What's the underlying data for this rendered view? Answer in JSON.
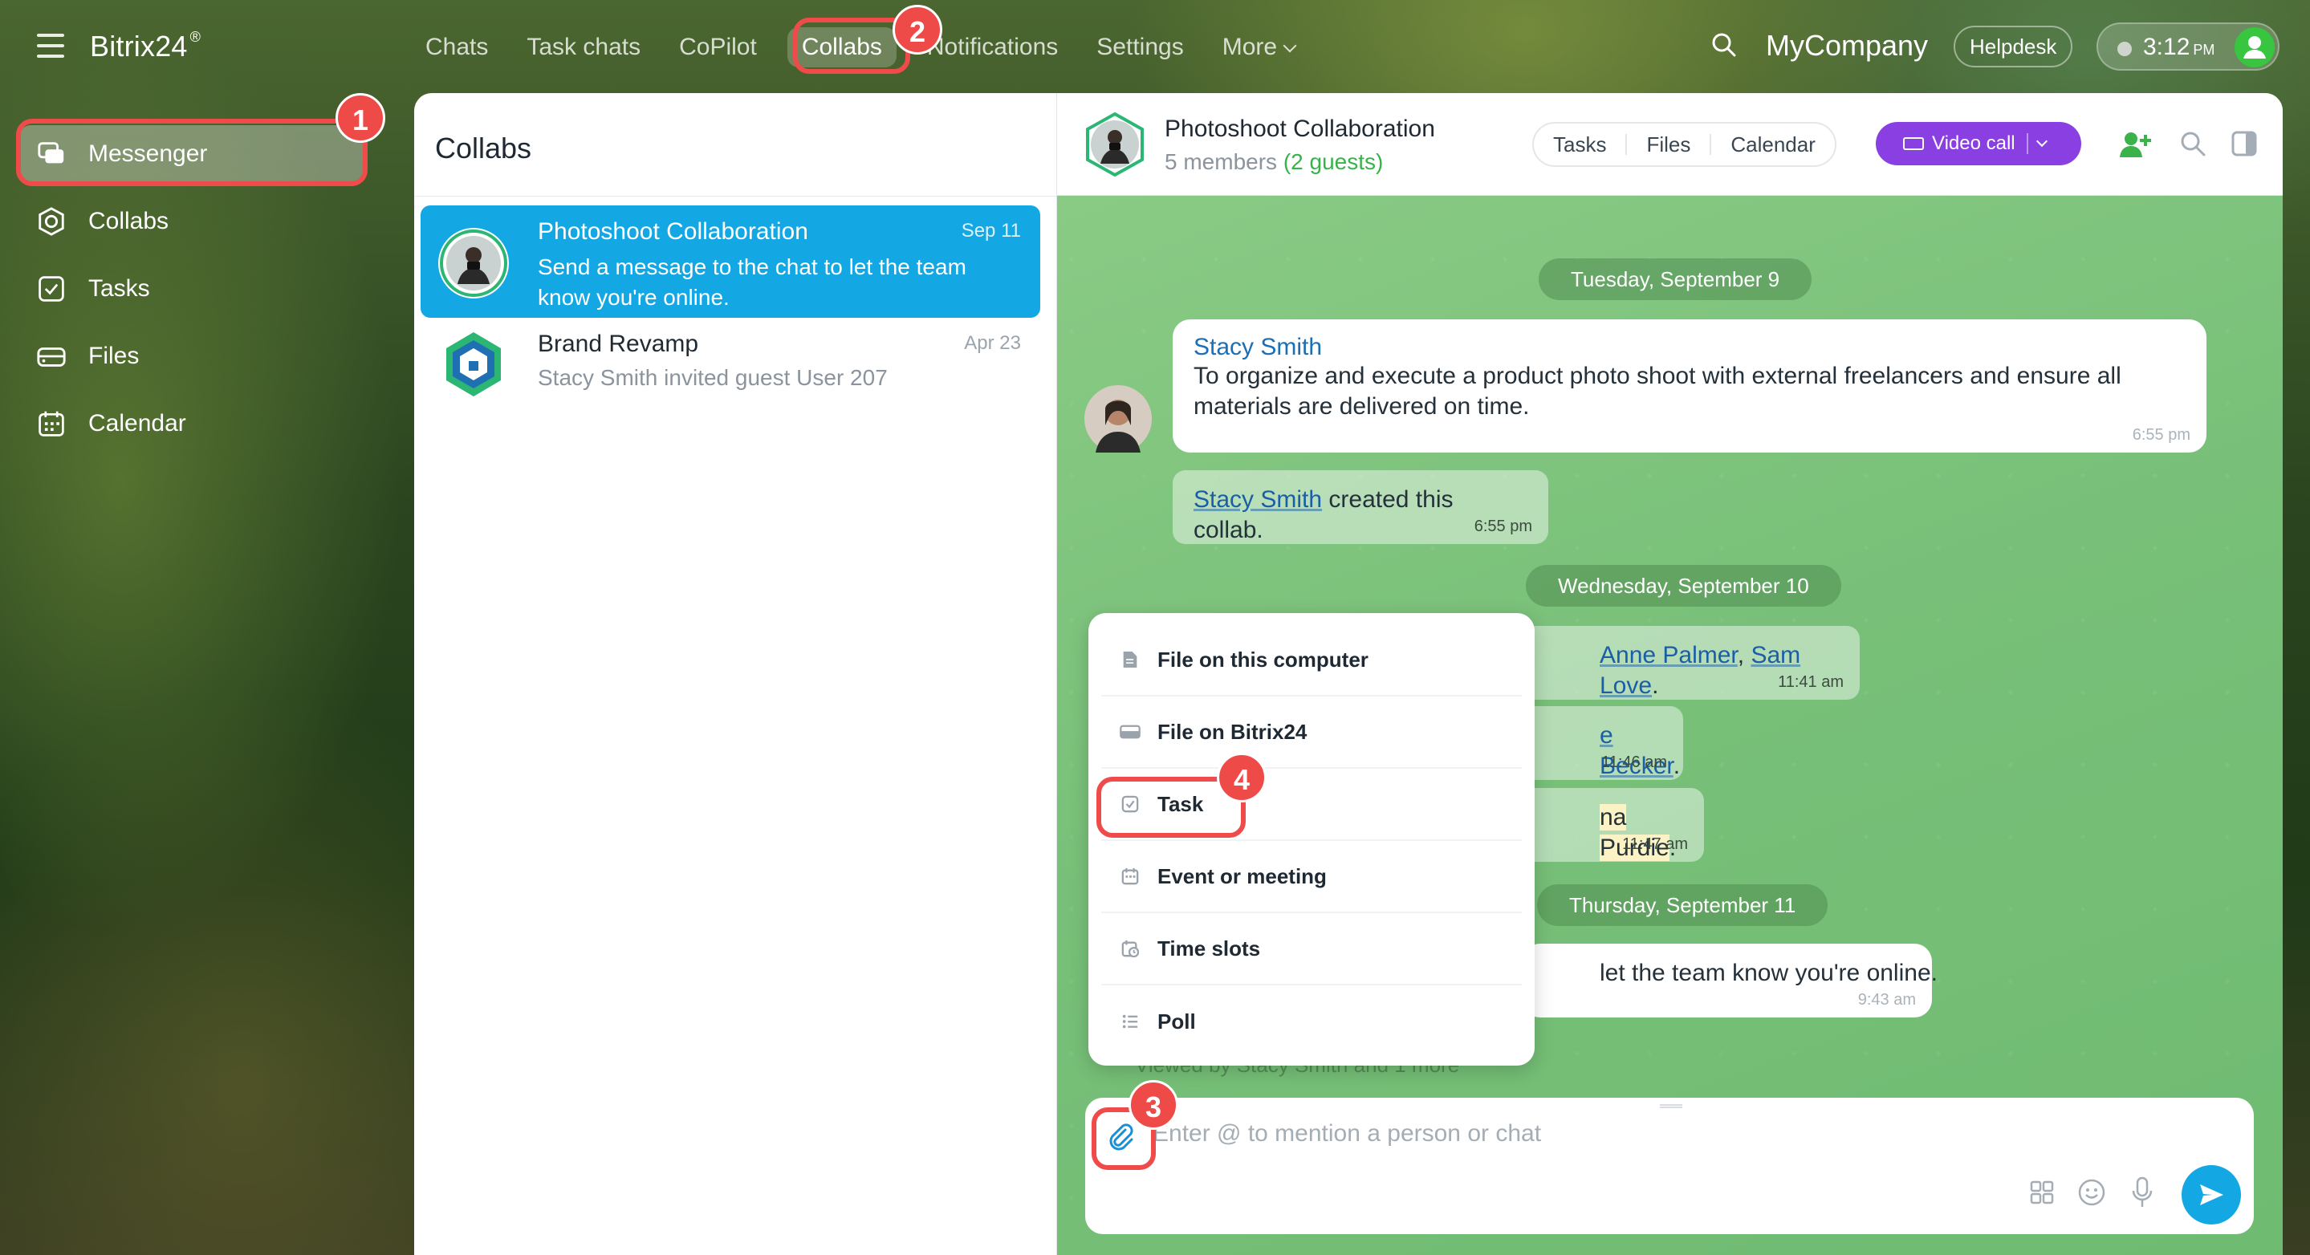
{
  "app": {
    "brand": "Bitrix24",
    "brand_mark": "®"
  },
  "topnav": {
    "items": [
      "Chats",
      "Task chats",
      "CoPilot",
      "Collabs",
      "Notifications",
      "Settings",
      "More"
    ],
    "company": "MyCompany",
    "helpdesk": "Helpdesk",
    "time": "3:12",
    "time_suffix": "PM"
  },
  "sidebar": {
    "items": [
      {
        "label": "Messenger",
        "icon": "messenger-icon"
      },
      {
        "label": "Collabs",
        "icon": "collabs-icon"
      },
      {
        "label": "Tasks",
        "icon": "tasks-icon"
      },
      {
        "label": "Files",
        "icon": "files-icon"
      },
      {
        "label": "Calendar",
        "icon": "calendar-icon"
      }
    ]
  },
  "list": {
    "title": "Collabs",
    "chats": [
      {
        "name": "Photoshoot Collaboration",
        "date": "Sep 11",
        "preview": "Send a message to the chat to let the team know you're online."
      },
      {
        "name": "Brand Revamp",
        "date": "Apr 23",
        "preview": "Stacy Smith invited guest User 207"
      }
    ]
  },
  "chat": {
    "title": "Photoshoot Collaboration",
    "members": "5 members",
    "guests": "(2 guests)",
    "tabs": [
      "Tasks",
      "Files",
      "Calendar"
    ],
    "video_call": "Video call",
    "dates": [
      "Tuesday, September 9",
      "Wednesday, September 10",
      "Thursday, September 11"
    ],
    "msg1": {
      "from": "Stacy Smith",
      "text": "To organize and execute a product photo shoot with external freelancers and ensure all materials are delivered on time.",
      "time": "6:55 pm"
    },
    "msg2": {
      "link": "Stacy Smith",
      "text": " created this collab.",
      "time": "6:55 pm"
    },
    "msg3": {
      "link1": "Anne Palmer",
      "sep": ", ",
      "link2": "Sam Love",
      "end": ".",
      "time": "11:41 am"
    },
    "msg4": {
      "link": "e Becker",
      "end": ".",
      "time": "11:46 am"
    },
    "msg5": {
      "hl": "na Purdie",
      "end": ".",
      "time": "11:47 am"
    },
    "msg6": {
      "text": "let the team know you're online.",
      "time": "9:43 am"
    },
    "viewed": "Viewed by Stacy Smith and 1 more"
  },
  "menu": {
    "items": [
      {
        "label": "File on this computer",
        "icon": "file-icon"
      },
      {
        "label": "File on Bitrix24",
        "icon": "drive-icon"
      },
      {
        "label": "Task",
        "icon": "task-icon"
      },
      {
        "label": "Event or meeting",
        "icon": "calendar-icon"
      },
      {
        "label": "Time slots",
        "icon": "time-slots-icon"
      },
      {
        "label": "Poll",
        "icon": "poll-icon"
      }
    ]
  },
  "composer": {
    "placeholder": "Enter @ to mention a person or chat"
  },
  "annotations": [
    "1",
    "2",
    "3",
    "4"
  ],
  "colors": {
    "accent": "#13a7e4",
    "video": "#8a3fe3",
    "annotation": "#ee4a47",
    "chat_bg": "#8fcf88",
    "guests": "#37b34a"
  }
}
